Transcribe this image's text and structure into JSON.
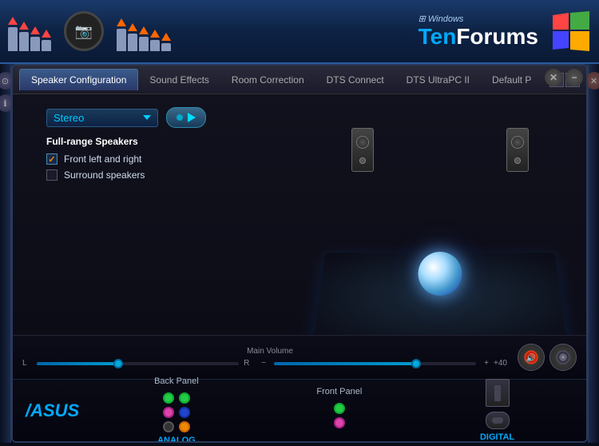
{
  "banner": {
    "site_name": "TenForums",
    "site_prefix": "Windows",
    "site_ten": "Ten",
    "site_forums": "Forums"
  },
  "app": {
    "title": "Speaker Configuration"
  },
  "tabs": [
    {
      "id": "speaker-config",
      "label": "Speaker Configuration",
      "active": true
    },
    {
      "id": "sound-effects",
      "label": "Sound Effects",
      "active": false
    },
    {
      "id": "room-correction",
      "label": "Room Correction",
      "active": false
    },
    {
      "id": "dts-connect",
      "label": "DTS Connect",
      "active": false
    },
    {
      "id": "dts-ultrapc",
      "label": "DTS UltraPC II",
      "active": false
    },
    {
      "id": "default",
      "label": "Default P",
      "active": false
    }
  ],
  "speaker_config": {
    "dropdown_value": "Stereo",
    "full_range_label": "Full-range Speakers",
    "options": [
      {
        "id": "front-lr",
        "label": "Front left and right",
        "checked": true
      },
      {
        "id": "surround",
        "label": "Surround speakers",
        "checked": false
      }
    ]
  },
  "volume": {
    "label": "Main Volume",
    "left_label": "L",
    "right_label": "R",
    "value_label": "+40",
    "fill_percent": 70
  },
  "footer": {
    "logo": "/ASUS",
    "back_panel_label": "Back Panel",
    "front_panel_label": "Front Panel",
    "analog_label": "ANALOG",
    "digital_label": "DIGITAL"
  }
}
